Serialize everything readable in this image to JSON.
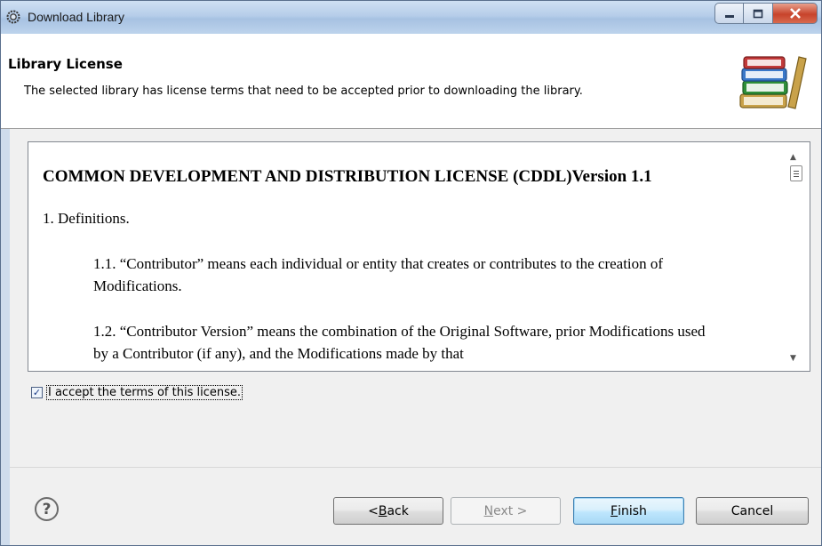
{
  "window": {
    "title": "Download Library",
    "icons": {
      "app": "gear-icon",
      "minimize": "minimize-icon",
      "maximize": "maximize-icon",
      "close": "close-icon"
    }
  },
  "header": {
    "title": "Library License",
    "description": "The selected library has license terms that need to be accepted prior to downloading the library.",
    "icon": "books-icon"
  },
  "license": {
    "heading": "COMMON DEVELOPMENT AND DISTRIBUTION LICENSE (CDDL)Version 1.1",
    "definitions_title": "1. Definitions.",
    "paragraphs": [
      "1.1. “Contributor” means each individual or entity that creates or contributes to the creation of Modifications.",
      "1.2. “Contributor Version” means the combination of the Original Software, prior Modifications used by a Contributor (if any), and the Modifications made by that"
    ]
  },
  "accept": {
    "label": "I accept the terms of this license.",
    "checked": true
  },
  "buttons": {
    "help": "?",
    "back": {
      "prefix": "< ",
      "mnemonic": "B",
      "rest": "ack"
    },
    "next": {
      "mnemonic": "N",
      "rest": "ext >",
      "enabled": false
    },
    "finish": {
      "mnemonic": "F",
      "rest": "inish",
      "default": true
    },
    "cancel": "Cancel"
  }
}
